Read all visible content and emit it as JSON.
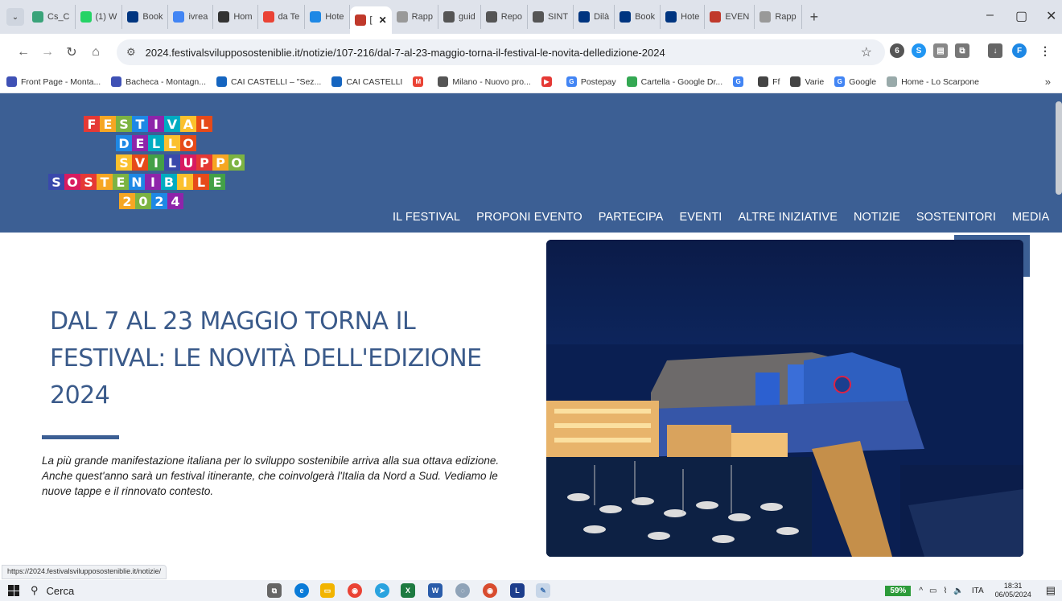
{
  "tabs": [
    {
      "label": "Cs_C",
      "icon": "hiker-icon",
      "color": "#3aa37a"
    },
    {
      "label": "(1) W",
      "icon": "whatsapp-icon",
      "color": "#25d366"
    },
    {
      "label": "Book",
      "icon": "booking-icon",
      "color": "#003580"
    },
    {
      "label": "ivrea",
      "icon": "google-icon",
      "color": "#4285f4"
    },
    {
      "label": "Hom",
      "icon": "home-icon",
      "color": "#333"
    },
    {
      "label": "da Te",
      "icon": "maps-pin-icon",
      "color": "#ea4335"
    },
    {
      "label": "Hote",
      "icon": "hotel-icon",
      "color": "#1e88e5"
    },
    {
      "label": "[",
      "icon": "festival-icon",
      "color": "#c0392b",
      "active": true
    },
    {
      "label": "Rapp",
      "icon": "loading-icon",
      "color": "#999"
    },
    {
      "label": "guid",
      "icon": "globe-icon",
      "color": "#555"
    },
    {
      "label": "Repo",
      "icon": "globe-icon",
      "color": "#555"
    },
    {
      "label": "SINT",
      "icon": "globe-icon",
      "color": "#555"
    },
    {
      "label": "Dilà",
      "icon": "booking-icon",
      "color": "#003580"
    },
    {
      "label": "Book",
      "icon": "booking-icon",
      "color": "#003580"
    },
    {
      "label": "Hote",
      "icon": "booking-icon",
      "color": "#003580"
    },
    {
      "label": "EVEN",
      "icon": "festival-icon",
      "color": "#c0392b"
    },
    {
      "label": "Rapp",
      "icon": "loading-icon",
      "color": "#999"
    }
  ],
  "address": {
    "url": "2024.festivalsviluppososteniblie.it/notizie/107-216/dal-7-al-23-maggio-torna-il-festival-le-novita-delledizione-2024"
  },
  "bookmarks": [
    {
      "label": "Front Page - Monta...",
      "color": "#3f51b5"
    },
    {
      "label": "Bacheca - Montagn...",
      "color": "#3f51b5"
    },
    {
      "label": "CAI CASTELLI – \"Sez...",
      "color": "#1565c0"
    },
    {
      "label": "CAI CASTELLI",
      "color": "#1565c0"
    },
    {
      "label": "",
      "color": "#ea4335",
      "glyph": "M"
    },
    {
      "label": "Milano - Nuovo pro...",
      "color": "#555"
    },
    {
      "label": "",
      "color": "#e53935",
      "glyph": "▶"
    },
    {
      "label": "Postepay",
      "color": "#4285f4",
      "glyph": "G"
    },
    {
      "label": "Cartella - Google Dr...",
      "color": "#34a853"
    },
    {
      "label": "",
      "color": "#4285f4",
      "glyph": "G"
    },
    {
      "label": "Ff",
      "color": "#444"
    },
    {
      "label": "Varie",
      "color": "#444"
    },
    {
      "label": "Google",
      "color": "#4285f4",
      "glyph": "G"
    },
    {
      "label": "Home - Lo Scarpone",
      "color": "#9aa"
    }
  ],
  "logo": {
    "rows": [
      [
        "F",
        "E",
        "S",
        "T",
        "I",
        "V",
        "A",
        "L"
      ],
      [
        "D",
        "E",
        "L",
        "L",
        "O"
      ],
      [
        "S",
        "V",
        "I",
        "L",
        "U",
        "P",
        "P",
        "O"
      ],
      [
        "S",
        "O",
        "S",
        "T",
        "E",
        "N",
        "I",
        "B",
        "I",
        "L",
        "E"
      ],
      [
        "2",
        "0",
        "2",
        "4"
      ]
    ]
  },
  "nav": [
    "IL FESTIVAL",
    "PROPONI EVENTO",
    "PARTECIPA",
    "EVENTI",
    "ALTRE INIZIATIVE",
    "NOTIZIE",
    "SOSTENITORI",
    "MEDIA"
  ],
  "article": {
    "title": "DAL 7 AL 23 MAGGIO TORNA IL FESTIVAL: LE NOVITÀ DELL'EDIZIONE 2024",
    "lead": "La più grande manifestazione italiana per lo sviluppo sostenibile arriva alla sua ottava edizione. Anche quest'anno sarà un festival itinerante, che coinvolgerà l'Italia da Nord a Sud. Vediamo le nuove tappe e il rinnovato contesto."
  },
  "status_url": "https://2024.festivalsviluppososteniblie.it/notizie/",
  "taskbar": {
    "search_label": "Cerca",
    "battery": "59%",
    "lang": "ITA",
    "time": "18:31",
    "date": "06/05/2024"
  },
  "colors": {
    "header": "#3c5f94",
    "title": "#3a5a8a"
  }
}
